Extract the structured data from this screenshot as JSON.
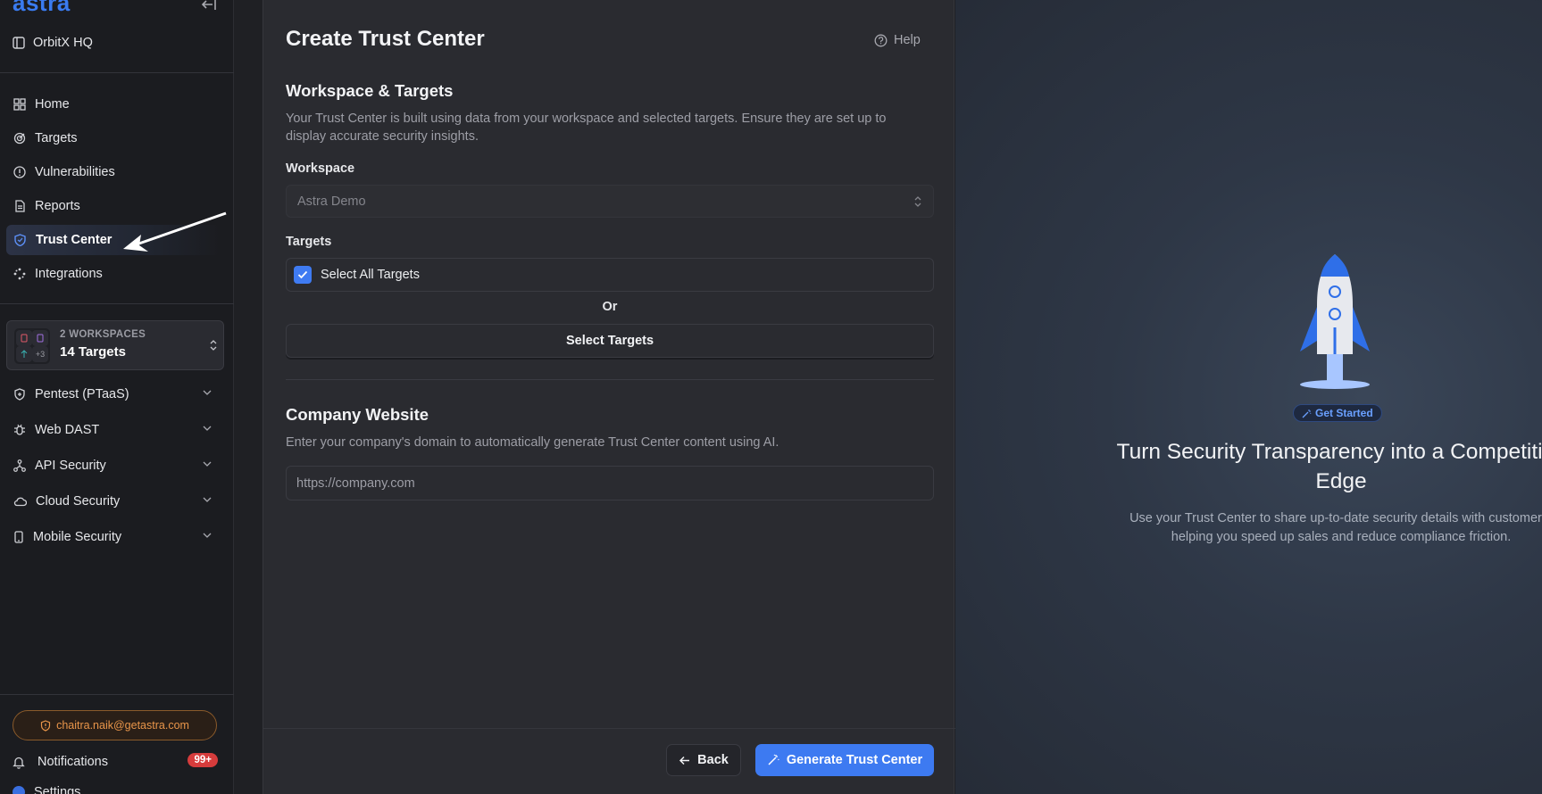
{
  "sidebar": {
    "logo": "astra",
    "org_name": "OrbitX HQ",
    "nav": [
      {
        "label": "Home",
        "icon": "grid-icon"
      },
      {
        "label": "Targets",
        "icon": "target-icon"
      },
      {
        "label": "Vulnerabilities",
        "icon": "alert-circle-icon"
      },
      {
        "label": "Reports",
        "icon": "document-icon"
      },
      {
        "label": "Trust Center",
        "icon": "shield-handshake-icon",
        "active": true
      },
      {
        "label": "Integrations",
        "icon": "integrations-icon"
      }
    ],
    "workspaces": {
      "title": "2 WORKSPACES",
      "count": "14 Targets",
      "extra": "+3"
    },
    "products": [
      {
        "label": "Pentest (PTaaS)",
        "icon": "shield-plus-icon"
      },
      {
        "label": "Web DAST",
        "icon": "bug-icon"
      },
      {
        "label": "API Security",
        "icon": "api-icon"
      },
      {
        "label": "Cloud Security",
        "icon": "cloud-icon"
      },
      {
        "label": "Mobile Security",
        "icon": "mobile-icon"
      }
    ],
    "user_email": "chaitra.naik@getastra.com",
    "notifications": {
      "label": "Notifications",
      "count": "99+"
    },
    "settings_label": "Settings"
  },
  "form": {
    "title": "Create Trust Center",
    "help_label": "Help",
    "workspace_section": {
      "title": "Workspace & Targets",
      "description": "Your Trust Center is built using data from your workspace and selected targets. Ensure they are set up to display accurate security insights.",
      "workspace_label": "Workspace",
      "workspace_value": "Astra Demo",
      "targets_label": "Targets",
      "select_all_label": "Select All Targets",
      "select_all_checked": true,
      "or_label": "Or",
      "select_targets_label": "Select Targets"
    },
    "company_section": {
      "title": "Company Website",
      "description": "Enter your company's domain to automatically generate Trust Center content using AI.",
      "website_placeholder": "https://company.com",
      "website_value": ""
    },
    "back_label": "Back",
    "generate_label": "Generate Trust Center"
  },
  "promo": {
    "badge": "Get Started",
    "title": "Turn Security Transparency into a Competitive Edge",
    "description": "Use your Trust Center to share up-to-date security details with customers-helping you speed up sales and reduce compliance friction."
  },
  "colors": {
    "accent": "#3d7af1",
    "badge_red": "#d63c3c",
    "email_orange": "#e8954a"
  }
}
